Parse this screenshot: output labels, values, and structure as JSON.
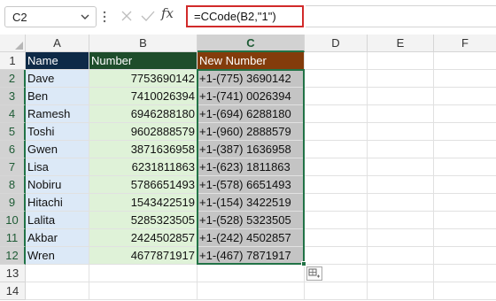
{
  "formula_bar": {
    "name_box": "C2",
    "fx_symbol": "fx",
    "formula": "=CCode(B2,\"1\")"
  },
  "columns": [
    "A",
    "B",
    "C",
    "D",
    "E",
    "F"
  ],
  "rows": [
    "1",
    "2",
    "3",
    "4",
    "5",
    "6",
    "7",
    "8",
    "9",
    "10",
    "11",
    "12",
    "13",
    "14"
  ],
  "headers": {
    "name": "Name",
    "number": "Number",
    "new_number": "New Number"
  },
  "table": [
    {
      "name": "Dave",
      "number": "7753690142",
      "new_number": "+1-(775) 3690142"
    },
    {
      "name": "Ben",
      "number": "7410026394",
      "new_number": "+1-(741) 0026394"
    },
    {
      "name": "Ramesh",
      "number": "6946288180",
      "new_number": "+1-(694) 6288180"
    },
    {
      "name": "Toshi",
      "number": "9602888579",
      "new_number": "+1-(960) 2888579"
    },
    {
      "name": "Gwen",
      "number": "3871636958",
      "new_number": "+1-(387) 1636958"
    },
    {
      "name": "Lisa",
      "number": "6231811863",
      "new_number": "+1-(623) 1811863"
    },
    {
      "name": "Nobiru",
      "number": "5786651493",
      "new_number": "+1-(578) 6651493"
    },
    {
      "name": "Hitachi",
      "number": "1543422519",
      "new_number": "+1-(154) 3422519"
    },
    {
      "name": "Lalita",
      "number": "5285323505",
      "new_number": "+1-(528) 5323505"
    },
    {
      "name": "Akbar",
      "number": "2424502857",
      "new_number": "+1-(242) 4502857"
    },
    {
      "name": "Wren",
      "number": "4677871917",
      "new_number": "+1-(467) 7871917"
    }
  ],
  "colors": {
    "header_name_bg": "#0e2a47",
    "header_number_bg": "#1e4d2b",
    "header_new_number_bg": "#833c0b",
    "col_a_bg": "#dce9f7",
    "col_b_bg": "#dff2d8",
    "col_c_bg": "#c4c4c4",
    "selection": "#217346",
    "formula_highlight": "#d12a2a"
  },
  "icons": {
    "name_box_dropdown": "chevron-down-icon",
    "more": "vertical-dots-icon",
    "cancel": "cancel-x-icon",
    "enter": "checkmark-icon",
    "autofill": "auto-fill-options-icon"
  }
}
